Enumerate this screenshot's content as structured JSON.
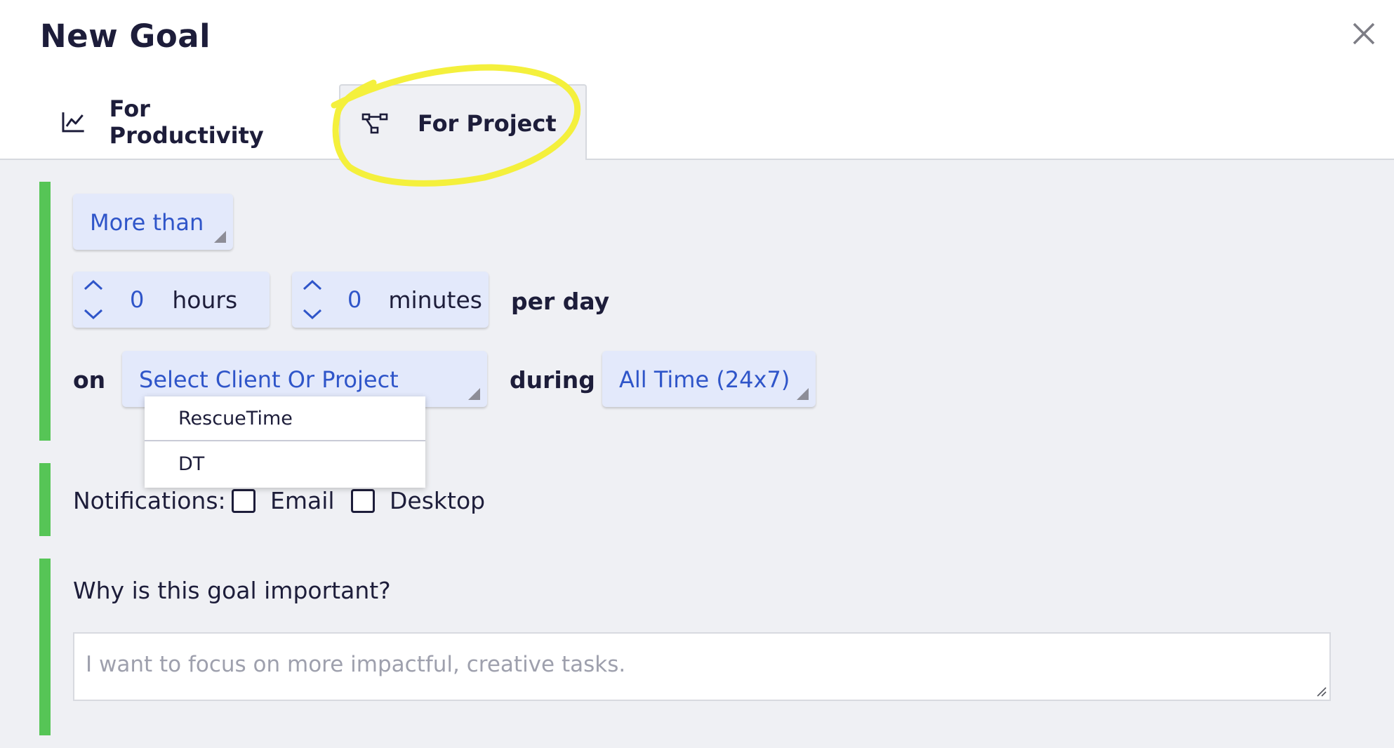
{
  "dialog": {
    "title": "New Goal"
  },
  "tabs": [
    {
      "label": "For Productivity",
      "icon": "line-chart-icon"
    },
    {
      "label": "For Project",
      "icon": "project-tree-icon",
      "active": true
    }
  ],
  "goal": {
    "comparator": "More than",
    "hours_value": "0",
    "hours_label": "hours",
    "minutes_value": "0",
    "minutes_label": "minutes",
    "per_label": "per day",
    "on_label": "on",
    "project_select": "Select Client Or Project",
    "during_label": "during",
    "time_select": "All Time (24x7)"
  },
  "project_dropdown": {
    "options": [
      "RescueTime",
      "DT"
    ]
  },
  "notifications": {
    "label": "Notifications:",
    "email_label": "Email",
    "desktop_label": "Desktop",
    "email_checked": false,
    "desktop_checked": false
  },
  "why": {
    "question": "Why is this goal important?",
    "placeholder": "I want to focus on more impactful, creative tasks."
  },
  "colors": {
    "accent_green": "#56c556",
    "link_blue": "#2f55c9",
    "highlight_yellow": "#f4f03c"
  }
}
